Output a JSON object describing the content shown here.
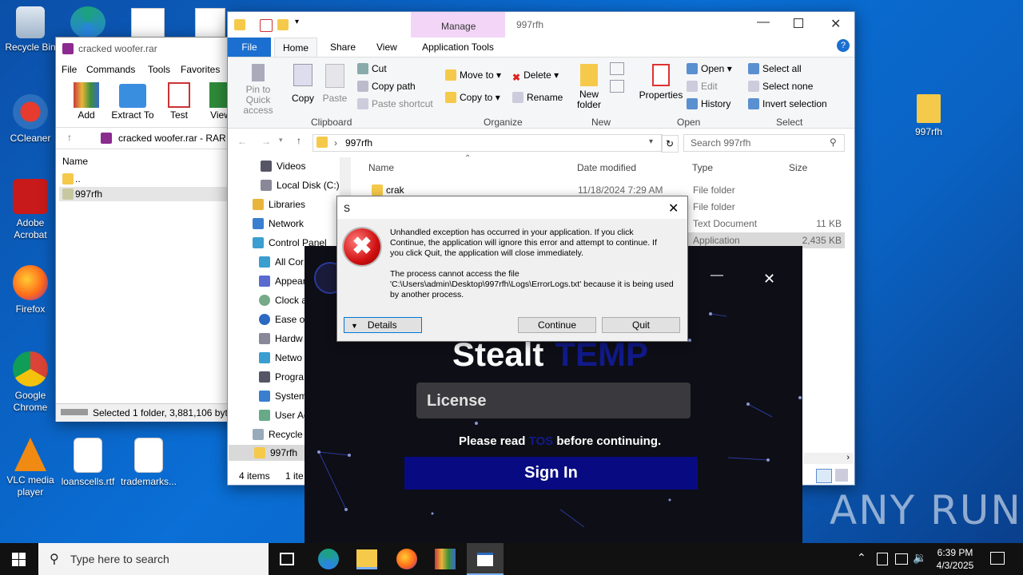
{
  "desktop": {
    "icons": [
      {
        "label": "Recycle Bin"
      },
      {
        "label": "CCleaner"
      },
      {
        "label": "Adobe Acrobat"
      },
      {
        "label": "Firefox"
      },
      {
        "label": "Google Chrome"
      },
      {
        "label": "VLC media player"
      },
      {
        "label": "loanscells.rtf"
      },
      {
        "label": "trademarks..."
      },
      {
        "label": "997rfh"
      }
    ],
    "watermark": "ANY RUN"
  },
  "winrar": {
    "title": "cracked woofer.rar",
    "menu": [
      "File",
      "Commands",
      "Tools",
      "Favorites"
    ],
    "toolbar": [
      "Add",
      "Extract To",
      "Test",
      "View"
    ],
    "path": "cracked woofer.rar - RAR a",
    "col_name": "Name",
    "rows": [
      "..",
      "997rfh"
    ],
    "status": "Selected 1 folder, 3,881,106 bytes"
  },
  "explorer": {
    "title": "997rfh",
    "manage": "Manage",
    "tabs": [
      "File",
      "Home",
      "Share",
      "View",
      "Application Tools"
    ],
    "clipboard": {
      "pin": "Pin to Quick access",
      "copy": "Copy",
      "paste": "Paste",
      "cut": "Cut",
      "copy_path": "Copy path",
      "paste_shortcut": "Paste shortcut",
      "label": "Clipboard"
    },
    "organize": {
      "move_to": "Move to",
      "copy_to": "Copy to",
      "delete": "Delete",
      "rename": "Rename",
      "label": "Organize"
    },
    "new": {
      "new_folder": "New folder",
      "label": "New"
    },
    "open": {
      "properties": "Properties",
      "open": "Open",
      "edit": "Edit",
      "history": "History",
      "label": "Open"
    },
    "select": {
      "all": "Select all",
      "none": "Select none",
      "invert": "Invert selection",
      "label": "Select"
    },
    "address": "997rfh",
    "search_placeholder": "Search 997rfh",
    "nav": [
      "Videos",
      "Local Disk (C:)",
      "Libraries",
      "Network",
      "Control Panel",
      "All Cor",
      "Appear",
      "Clock a",
      "Ease of",
      "Hardw",
      "Netwo",
      "Progra",
      "System",
      "User Ac",
      "Recycle",
      "997rfh"
    ],
    "columns": [
      "Name",
      "Date modified",
      "Type",
      "Size"
    ],
    "files": [
      {
        "name": "crak",
        "date": "11/18/2024 7:29 AM",
        "type": "File folder",
        "size": ""
      },
      {
        "name": "",
        "date": "",
        "type": "File folder",
        "size": ""
      },
      {
        "name": "",
        "date": "",
        "type": "Text Document",
        "size": "11 KB"
      },
      {
        "name": "",
        "date": "",
        "type": "Application",
        "size": "2,435 KB"
      }
    ],
    "status_items": "4 items",
    "status_sel": "1 ite"
  },
  "app": {
    "title_a": "Stealt",
    "title_b": "TEMP",
    "license_placeholder": "License",
    "tos_prefix": "Please read",
    "tos_link": "TOS",
    "tos_suffix": "before continuing.",
    "sign_in": "Sign In"
  },
  "dialog": {
    "title": "S",
    "message": "Unhandled exception has occurred in your application. If you click Continue, the application will ignore this error and attempt to continue. If you click Quit, the application will close immediately.",
    "detail": "The process cannot access the file 'C:\\Users\\admin\\Desktop\\997rfh\\Logs\\ErrorLogs.txt' because it is being used by another process.",
    "details_btn": "Details",
    "continue_btn": "Continue",
    "quit_btn": "Quit"
  },
  "taskbar": {
    "search_placeholder": "Type here to search",
    "time": "6:39 PM",
    "date": "4/3/2025"
  }
}
